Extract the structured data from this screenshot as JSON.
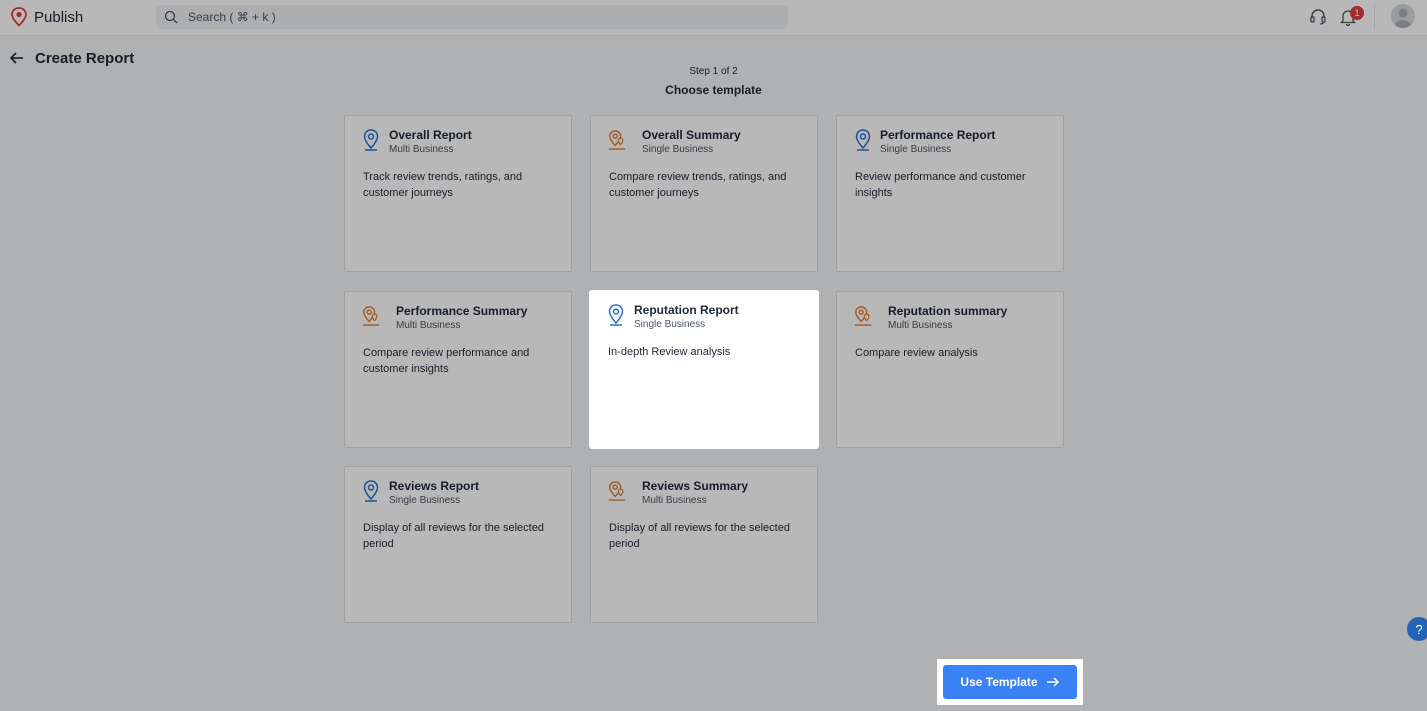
{
  "app": {
    "name": "Publish"
  },
  "search": {
    "placeholder": "Search ( ⌘ + k )"
  },
  "notifications": {
    "count": "1"
  },
  "header": {
    "title": "Create Report"
  },
  "wizard": {
    "step": "Step 1 of 2",
    "subtitle": "Choose template"
  },
  "templates": [
    {
      "name": "Overall Report",
      "scope": "Multi Business",
      "desc": "Track review trends, ratings, and customer journeys",
      "icon": "location-pin-icon",
      "color": "#2d6ed0"
    },
    {
      "name": "Overall Summary",
      "scope": "Single Business",
      "desc": "Compare review trends, ratings, and customer journeys",
      "icon": "location-multi-icon",
      "color": "#e07a2e"
    },
    {
      "name": "Performance Report",
      "scope": "Single Business",
      "desc": "Review performance and customer insights",
      "icon": "location-pin-icon",
      "color": "#2d6ed0"
    },
    {
      "name": "Performance Summary",
      "scope": "Multi Business",
      "desc": "Compare review performance and customer insights",
      "icon": "location-multi-icon",
      "color": "#e07a2e"
    },
    {
      "name": "Reputation Report",
      "scope": "Single Business",
      "desc": "In-depth Review analysis",
      "icon": "location-pin-icon",
      "color": "#2d6ed0"
    },
    {
      "name": "Reputation summary",
      "scope": "Multi Business",
      "desc": "Compare review analysis",
      "icon": "location-multi-icon",
      "color": "#e07a2e"
    },
    {
      "name": "Reviews Report",
      "scope": "Single Business",
      "desc": "Display of all reviews for the selected period",
      "icon": "location-pin-icon",
      "color": "#2d6ed0"
    },
    {
      "name": "Reviews Summary",
      "scope": "Multi Business",
      "desc": "Display of all reviews for the selected period",
      "icon": "location-multi-icon",
      "color": "#e07a2e"
    }
  ],
  "actions": {
    "use_template": "Use Template"
  },
  "colors": {
    "primary": "#3b82f6",
    "accent_orange": "#e07a2e",
    "accent_blue": "#2d6ed0"
  }
}
